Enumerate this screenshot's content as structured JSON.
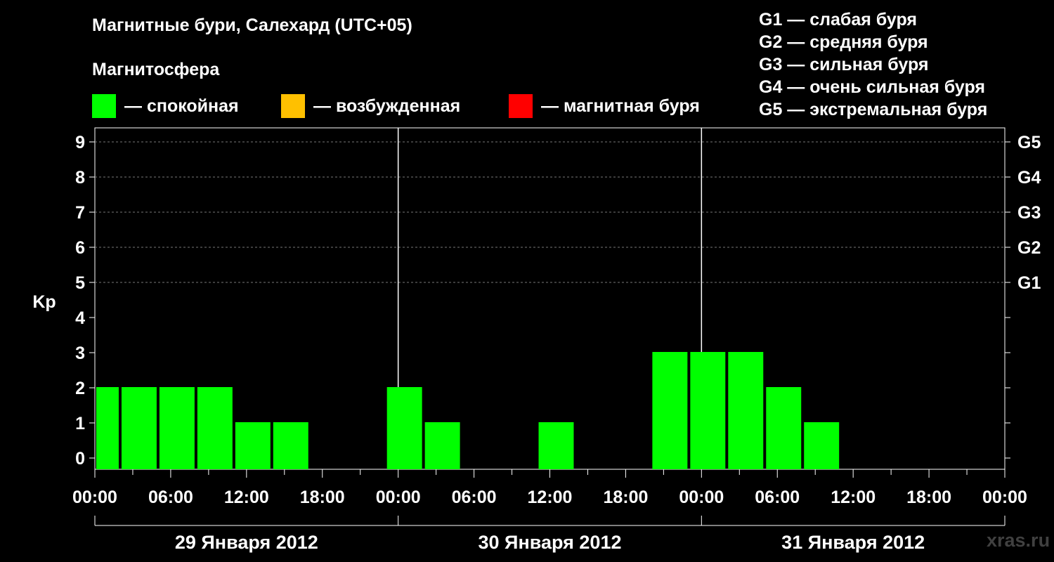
{
  "header": {
    "title": "Магнитные бури, Салехард (UTC+05)",
    "subtitle": "Магнитосфера"
  },
  "legend": [
    {
      "color": "#00ff00",
      "label": "— спокойная"
    },
    {
      "color": "#ffc000",
      "label": "— возбужденная"
    },
    {
      "color": "#ff0000",
      "label": "— магнитная буря"
    }
  ],
  "g_legend": [
    "G1 — слабая буря",
    "G2 — средняя буря",
    "G3 — сильная буря",
    "G4 — очень сильная буря",
    "G5 — экстремальная буря"
  ],
  "watermark": "xras.ru",
  "chart_data": {
    "type": "bar",
    "ylabel": "Kp",
    "ylim": [
      0,
      9
    ],
    "yticks": [
      "0",
      "1",
      "2",
      "3",
      "4",
      "5",
      "6",
      "7",
      "8",
      "9"
    ],
    "right_ticks": [
      {
        "y": 5,
        "label": "G1"
      },
      {
        "y": 6,
        "label": "G2"
      },
      {
        "y": 7,
        "label": "G3"
      },
      {
        "y": 8,
        "label": "G4"
      },
      {
        "y": 9,
        "label": "G5"
      }
    ],
    "xlim_hours": [
      0,
      72
    ],
    "xticks": [
      "00:00",
      "06:00",
      "12:00",
      "18:00",
      "00:00",
      "06:00",
      "12:00",
      "18:00",
      "00:00",
      "06:00",
      "12:00",
      "18:00",
      "00:00"
    ],
    "days": [
      "29 Января 2012",
      "30 Января 2012",
      "31 Января 2012"
    ],
    "grid": "dashed horizontal at Kp 5–9",
    "colors": {
      "quiet": "#00ff00",
      "active": "#ffc000",
      "storm": "#ff0000"
    },
    "series": [
      {
        "values": [
          {
            "start": 0,
            "end": 2,
            "kp": 2
          },
          {
            "start": 2,
            "end": 5,
            "kp": 2
          },
          {
            "start": 5,
            "end": 8,
            "kp": 2
          },
          {
            "start": 8,
            "end": 11,
            "kp": 2
          },
          {
            "start": 11,
            "end": 14,
            "kp": 1
          },
          {
            "start": 14,
            "end": 17,
            "kp": 1
          },
          {
            "start": 17,
            "end": 20,
            "kp": 0
          },
          {
            "start": 20,
            "end": 23,
            "kp": 0
          },
          {
            "start": 23,
            "end": 26,
            "kp": 2
          },
          {
            "start": 26,
            "end": 29,
            "kp": 1
          },
          {
            "start": 29,
            "end": 32,
            "kp": 0
          },
          {
            "start": 32,
            "end": 35,
            "kp": 0
          },
          {
            "start": 35,
            "end": 38,
            "kp": 1
          },
          {
            "start": 38,
            "end": 41,
            "kp": 0
          },
          {
            "start": 41,
            "end": 44,
            "kp": 0
          },
          {
            "start": 44,
            "end": 47,
            "kp": 3
          },
          {
            "start": 47,
            "end": 50,
            "kp": 3
          },
          {
            "start": 50,
            "end": 53,
            "kp": 3
          },
          {
            "start": 53,
            "end": 56,
            "kp": 2
          },
          {
            "start": 56,
            "end": 59,
            "kp": 1
          }
        ]
      }
    ]
  }
}
